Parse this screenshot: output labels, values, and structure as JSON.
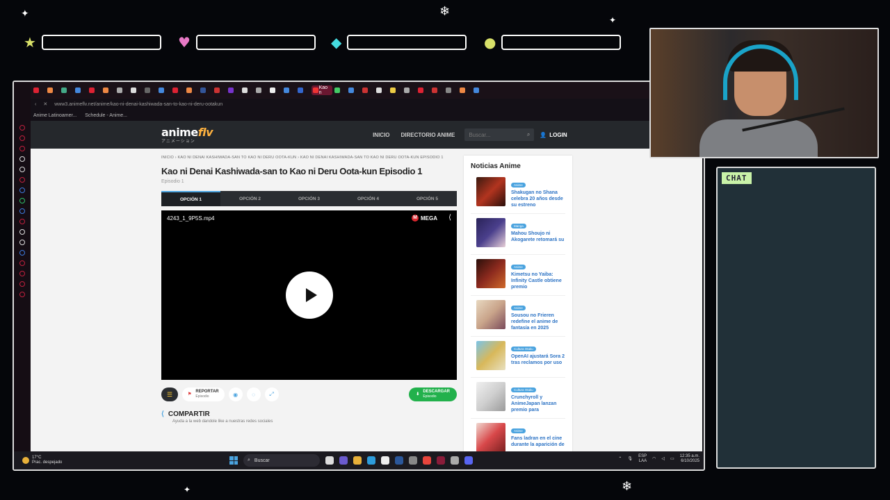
{
  "browser": {
    "active_tab_label": "Kao n",
    "url": "www3.animeflv.net/anime/kao-ni-denai-kashiwada-san-to-kao-ni-deru-ootakun",
    "bookmarks": [
      "Anime Latinoamer...",
      "Schedule - Anime..."
    ]
  },
  "site": {
    "logo_main": "anime",
    "logo_accent": "flv",
    "logo_sub": "アニメーション",
    "nav": [
      "INICIO",
      "DIRECTORIO ANIME"
    ],
    "search_placeholder": "Buscar...",
    "login_label": "LOGIN"
  },
  "breadcrumb": "INICIO  ›  KAO NI DENAI KASHIWADA-SAN TO KAO NI DERU OOTA-KUN  ›  KAO NI DENAI KASHIWADA-SAN TO KAO NI DERU OOTA-KUN EPISODIO 1",
  "episode": {
    "title": "Kao ni Denai Kashiwada-san to Kao ni Deru Oota-kun Episodio 1",
    "subtitle": "Episodio 1"
  },
  "options": [
    "OPCIÓN 1",
    "OPCIÓN 2",
    "OPCIÓN 3",
    "OPCIÓN 4",
    "OPCIÓN 5"
  ],
  "player": {
    "filename": "4243_1_9P5S.mp4",
    "host": "MEGA"
  },
  "actions": {
    "report_label": "REPORTAR",
    "report_sub": "Episodio",
    "download_label": "DESCARGAR",
    "download_sub": "Episodio"
  },
  "share": {
    "title": "COMPARTIR",
    "subtitle": "Ayuda a la web dandole like a nuestras redes sociales"
  },
  "news": {
    "title": "Noticias Anime",
    "items": [
      {
        "tag": "Anime",
        "text": "Shakugan no Shana celebra 20 años desde su estreno",
        "color": "#b2341f"
      },
      {
        "tag": "Manga",
        "text": "Mahou Shoujo ni Akogarete retomará su",
        "color": "#4a3f8c"
      },
      {
        "tag": "Anime",
        "text": "Kimetsu no Yaiba: Infinity Castle obtiene premio",
        "color": "#8c2a1e"
      },
      {
        "tag": "Anime",
        "text": "Sousou no Frieren redefine el anime de fantasía en 2025",
        "color": "#c9a48a"
      },
      {
        "tag": "Cultura Otaku",
        "text": "OpenAI ajustará Sora 2 tras reclamos por uso",
        "color": "#d8b85a"
      },
      {
        "tag": "Cultura Otaku",
        "text": "Crunchyroll y AnimeJapan lanzan premio para",
        "color": "#cfcfcf"
      },
      {
        "tag": "Anime",
        "text": "Fans ladran en el cine durante la aparición de",
        "color": "#d8484a"
      }
    ]
  },
  "taskbar": {
    "temp": "17°C",
    "weather": "Prac. despejado",
    "search": "Buscar",
    "lang": "ESP",
    "lang2": "LAA",
    "time": "12:35 a.m.",
    "date": "6/10/2025"
  },
  "chat_label": "CHAT"
}
